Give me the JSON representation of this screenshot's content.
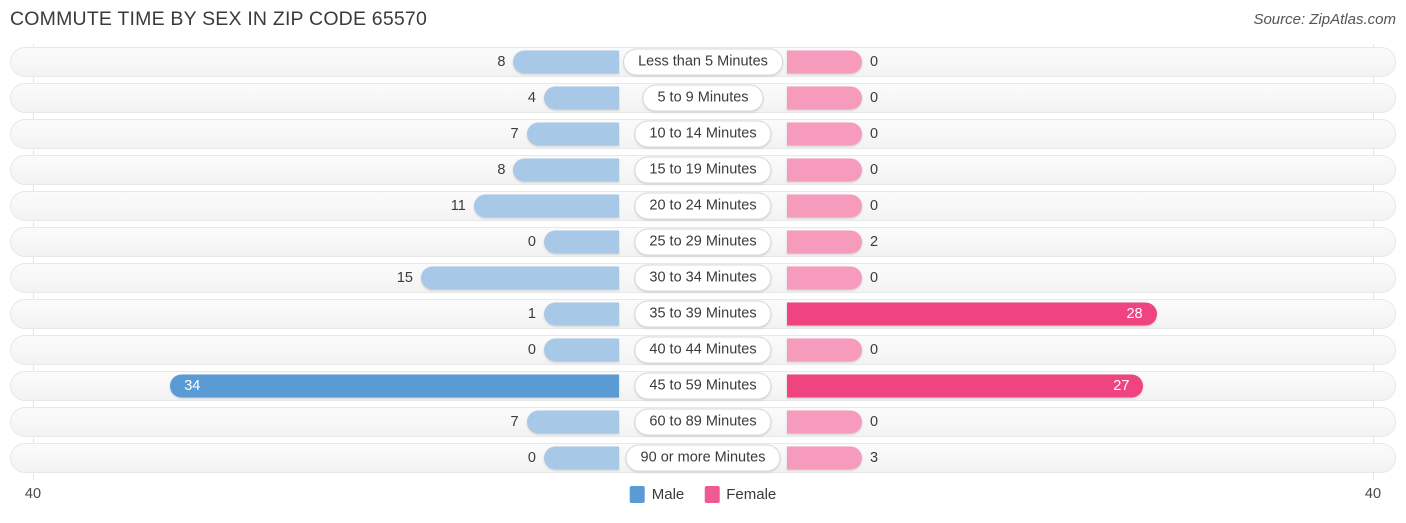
{
  "header": {
    "title": "COMMUTE TIME BY SEX IN ZIP CODE 65570",
    "source": "Source: ZipAtlas.com"
  },
  "legend": {
    "items": [
      {
        "label": "Male",
        "color": "#5b9bd5"
      },
      {
        "label": "Female",
        "color": "#ef5a92"
      }
    ]
  },
  "axis": {
    "left_label": "40",
    "right_label": "40"
  },
  "colors": {
    "male_strong": "#5b9bd5",
    "male_light": "#a8c8e8",
    "female_strong": "#ef447f",
    "female_light": "#f79bbd",
    "track_bg": "#f7f7f7",
    "track_border": "#e8e8e8",
    "gridline": "#e4e4e4",
    "text": "#3b3b3b"
  },
  "chart_data": {
    "type": "bar",
    "title": "COMMUTE TIME BY SEX IN ZIP CODE 65570",
    "subtitle": "",
    "xlabel": "",
    "ylabel": "",
    "orientation": "horizontal-diverging",
    "xlim": [
      -40,
      40
    ],
    "axis_max": 40,
    "grid": true,
    "legend_position": "bottom-center",
    "categories": [
      "Less than 5 Minutes",
      "5 to 9 Minutes",
      "10 to 14 Minutes",
      "15 to 19 Minutes",
      "20 to 24 Minutes",
      "25 to 29 Minutes",
      "30 to 34 Minutes",
      "35 to 39 Minutes",
      "40 to 44 Minutes",
      "45 to 59 Minutes",
      "60 to 89 Minutes",
      "90 or more Minutes"
    ],
    "series": [
      {
        "name": "Male",
        "color": "#5b9bd5",
        "values": [
          8,
          4,
          7,
          8,
          11,
          0,
          15,
          1,
          0,
          34,
          7,
          0
        ]
      },
      {
        "name": "Female",
        "color": "#ef447f",
        "values": [
          0,
          0,
          0,
          0,
          0,
          2,
          0,
          28,
          0,
          27,
          0,
          3
        ]
      }
    ]
  }
}
